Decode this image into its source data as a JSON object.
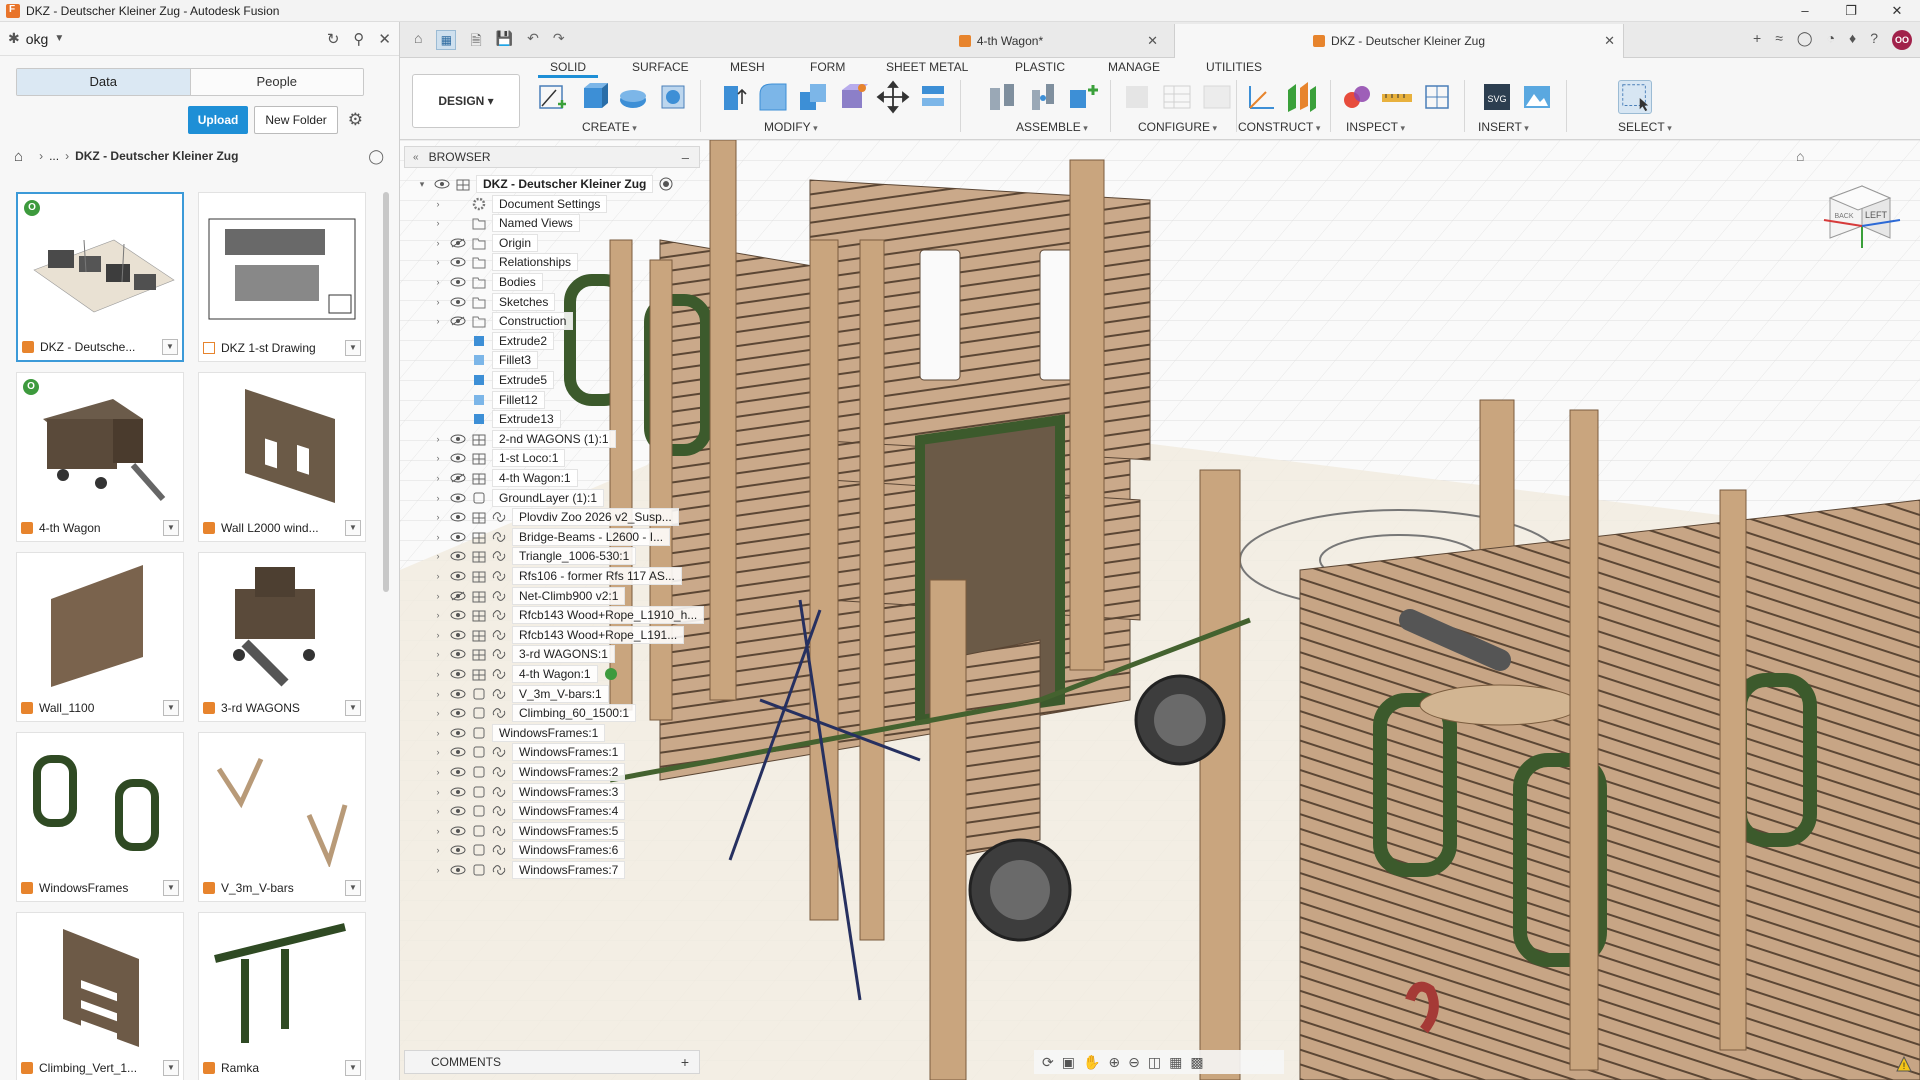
{
  "window": {
    "title": "DKZ - Deutscher Kleiner Zug - Autodesk Fusion"
  },
  "data_panel": {
    "team": "okg",
    "tabs": [
      "Data",
      "People"
    ],
    "upload_label": "Upload",
    "new_folder_label": "New Folder",
    "breadcrumb": {
      "ellipsis": "...",
      "current": "DKZ - Deutscher Kleiner Zug"
    },
    "files": [
      {
        "name": "DKZ - Deutsche...",
        "type": "design",
        "badge": "O"
      },
      {
        "name": "DKZ 1-st Drawing",
        "type": "drawing"
      },
      {
        "name": "4-th Wagon",
        "type": "design",
        "badge": "O"
      },
      {
        "name": "Wall L2000 wind...",
        "type": "design"
      },
      {
        "name": "Wall_1100",
        "type": "design"
      },
      {
        "name": "3-rd WAGONS",
        "type": "design"
      },
      {
        "name": "WindowsFrames",
        "type": "design"
      },
      {
        "name": "V_3m_V-bars",
        "type": "design"
      },
      {
        "name": "Climbing_Vert_1...",
        "type": "design"
      },
      {
        "name": "Ramka",
        "type": "design"
      }
    ]
  },
  "doc_tabs": [
    {
      "label": "4-th Wagon*"
    },
    {
      "label": "DKZ - Deutscher Kleiner Zug"
    }
  ],
  "avatar_initials": "OO",
  "ribbon": {
    "workspace": "DESIGN",
    "tabs": [
      "SOLID",
      "SURFACE",
      "MESH",
      "FORM",
      "SHEET METAL",
      "PLASTIC",
      "MANAGE",
      "UTILITIES"
    ],
    "groups": [
      "CREATE",
      "MODIFY",
      "ASSEMBLE",
      "CONFIGURE",
      "CONSTRUCT",
      "INSPECT",
      "INSERT",
      "SELECT"
    ]
  },
  "browser": {
    "title": "BROWSER",
    "root": "DKZ - Deutscher Kleiner Zug",
    "items": [
      {
        "label": "Document Settings",
        "icon": "gear-icon",
        "eye": "none",
        "arrow": true,
        "link": false
      },
      {
        "label": "Named Views",
        "icon": "folder-icon",
        "eye": "none",
        "arrow": true,
        "link": false
      },
      {
        "label": "Origin",
        "icon": "folder-icon",
        "eye": "hidden",
        "arrow": true,
        "link": false
      },
      {
        "label": "Relationships",
        "icon": "folder-icon",
        "eye": "visible",
        "arrow": true,
        "link": false
      },
      {
        "label": "Bodies",
        "icon": "folder-icon",
        "eye": "visible",
        "arrow": true,
        "link": false
      },
      {
        "label": "Sketches",
        "icon": "folder-icon",
        "eye": "visible",
        "arrow": true,
        "link": false
      },
      {
        "label": "Construction",
        "icon": "folder-icon",
        "eye": "hidden",
        "arrow": true,
        "link": false
      },
      {
        "label": "Extrude2",
        "icon": "body-icon",
        "eye": "none",
        "arrow": false,
        "link": false
      },
      {
        "label": "Fillet3",
        "icon": "fillet-icon",
        "eye": "none",
        "arrow": false,
        "link": false
      },
      {
        "label": "Extrude5",
        "icon": "body-icon",
        "eye": "none",
        "arrow": false,
        "link": false
      },
      {
        "label": "Fillet12",
        "icon": "fillet-icon",
        "eye": "none",
        "arrow": false,
        "link": false
      },
      {
        "label": "Extrude13",
        "icon": "body-icon",
        "eye": "none",
        "arrow": false,
        "link": false
      },
      {
        "label": "2-nd WAGONS (1):1",
        "icon": "component-icon",
        "eye": "visible",
        "arrow": true,
        "link": false
      },
      {
        "label": "1-st Loco:1",
        "icon": "component-icon",
        "eye": "visible",
        "arrow": true,
        "link": false
      },
      {
        "label": "4-th Wagon:1",
        "icon": "component-icon",
        "eye": "hidden",
        "arrow": true,
        "link": false
      },
      {
        "label": "GroundLayer (1):1",
        "icon": "part-icon",
        "eye": "visible",
        "arrow": true,
        "link": false
      },
      {
        "label": "Plovdiv Zoo 2026 v2_Susp...",
        "icon": "component-icon",
        "eye": "visible",
        "arrow": true,
        "link": true
      },
      {
        "label": "Bridge-Beams - L2600 - I...",
        "icon": "component-icon",
        "eye": "visible",
        "arrow": true,
        "link": true
      },
      {
        "label": "Triangle_1006-530:1",
        "icon": "component-icon",
        "eye": "visible",
        "arrow": true,
        "link": true
      },
      {
        "label": "Rfs106 - former Rfs 117 AS...",
        "icon": "component-icon",
        "eye": "visible",
        "arrow": true,
        "link": true
      },
      {
        "label": "Net-Climb900 v2:1",
        "icon": "component-icon",
        "eye": "hidden",
        "arrow": true,
        "link": true
      },
      {
        "label": "Rfcb143 Wood+Rope_L1910_h...",
        "icon": "component-icon",
        "eye": "visible",
        "arrow": true,
        "link": true
      },
      {
        "label": "Rfcb143 Wood+Rope_L191...",
        "icon": "component-icon",
        "eye": "visible",
        "arrow": true,
        "link": true
      },
      {
        "label": "3-rd WAGONS:1",
        "icon": "component-icon",
        "eye": "visible",
        "arrow": true,
        "link": true
      },
      {
        "label": "4-th Wagon:1",
        "icon": "component-icon",
        "eye": "visible",
        "arrow": true,
        "link": true,
        "badge": true
      },
      {
        "label": "V_3m_V-bars:1",
        "icon": "part-icon",
        "eye": "visible",
        "arrow": true,
        "link": true
      },
      {
        "label": "Climbing_60_1500:1",
        "icon": "part-icon",
        "eye": "visible",
        "arrow": true,
        "link": true
      },
      {
        "label": "WindowsFrames:1",
        "icon": "part-icon",
        "eye": "visible",
        "arrow": true,
        "link": false
      },
      {
        "label": "WindowsFrames:1",
        "icon": "part-icon",
        "eye": "visible",
        "arrow": true,
        "link": true
      },
      {
        "label": "WindowsFrames:2",
        "icon": "part-icon",
        "eye": "visible",
        "arrow": true,
        "link": true
      },
      {
        "label": "WindowsFrames:3",
        "icon": "part-icon",
        "eye": "visible",
        "arrow": true,
        "link": true
      },
      {
        "label": "WindowsFrames:4",
        "icon": "part-icon",
        "eye": "visible",
        "arrow": true,
        "link": true
      },
      {
        "label": "WindowsFrames:5",
        "icon": "part-icon",
        "eye": "visible",
        "arrow": true,
        "link": true
      },
      {
        "label": "WindowsFrames:6",
        "icon": "part-icon",
        "eye": "visible",
        "arrow": true,
        "link": true
      },
      {
        "label": "WindowsFrames:7",
        "icon": "part-icon",
        "eye": "visible",
        "arrow": true,
        "link": true
      }
    ]
  },
  "comments_label": "COMMENTS",
  "viewcube": {
    "face_left": "LEFT",
    "face_back": "BACK"
  },
  "colors": {
    "accent": "#1e8fd6",
    "wood": "#c9a57e",
    "frame_green": "#3c5a2c",
    "ground": "#f1ebdf"
  }
}
